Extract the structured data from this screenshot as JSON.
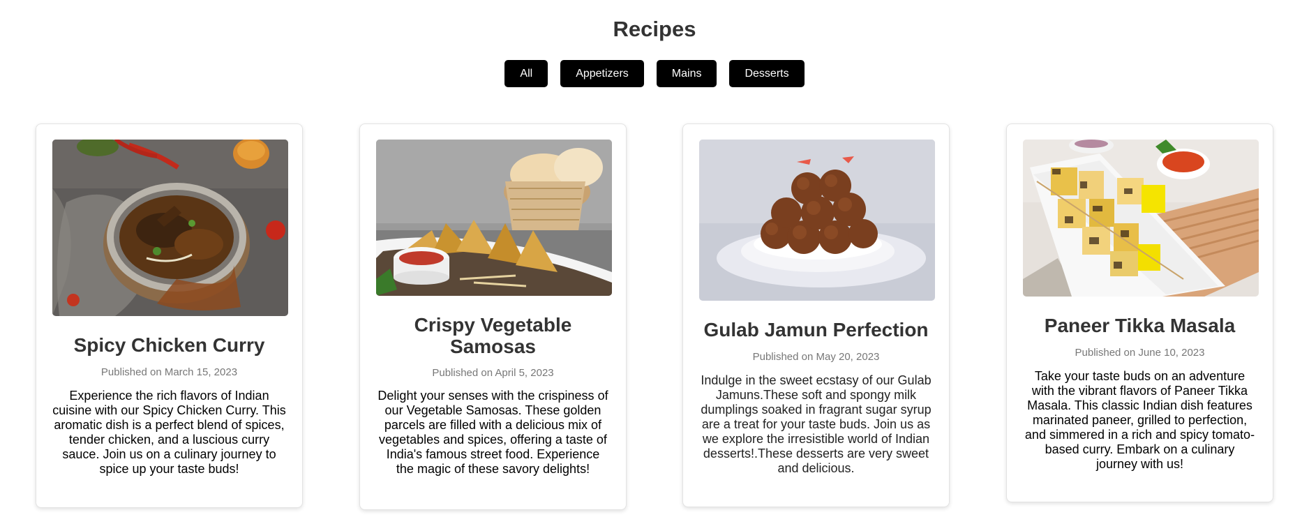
{
  "page": {
    "title": "Recipes"
  },
  "filters": [
    {
      "label": "All"
    },
    {
      "label": "Appetizers"
    },
    {
      "label": "Mains"
    },
    {
      "label": "Desserts"
    }
  ],
  "recipes": [
    {
      "title": "Spicy Chicken Curry",
      "date": "Published on March 15, 2023",
      "description": "Experience the rich flavors of Indian cuisine with our Spicy Chicken Curry. This aromatic dish is a perfect blend of spices, tender chicken, and a luscious curry sauce. Join us on a culinary journey to spice up your taste buds!",
      "image": "chicken-curry-photo"
    },
    {
      "title": "Crispy Vegetable Samosas",
      "date": "Published on April 5, 2023",
      "description": "Delight your senses with the crispiness of our Vegetable Samosas. These golden parcels are filled with a delicious mix of vegetables and spices, offering a taste of India's famous street food. Experience the magic of these savory delights!",
      "image": "samosas-photo"
    },
    {
      "title": "Gulab Jamun Perfection",
      "date": "Published on May 20, 2023",
      "description": "Indulge in the sweet ecstasy of our Gulab Jamuns.These soft and spongy milk dumplings soaked in fragrant sugar syrup are a treat for your taste buds. Join us as we explore the irresistible world of Indian desserts!.These desserts are very sweet and delicious.",
      "image": "gulab-jamun-photo"
    },
    {
      "title": "Paneer Tikka Masala",
      "date": "Published on June 10, 2023",
      "description": "Take your taste buds on an adventure with the vibrant flavors of Paneer Tikka Masala. This classic Indian dish features marinated paneer, grilled to perfection, and simmered in a rich and spicy tomato-based curry. Embark on a culinary journey with us!",
      "image": "paneer-tikka-photo"
    }
  ]
}
